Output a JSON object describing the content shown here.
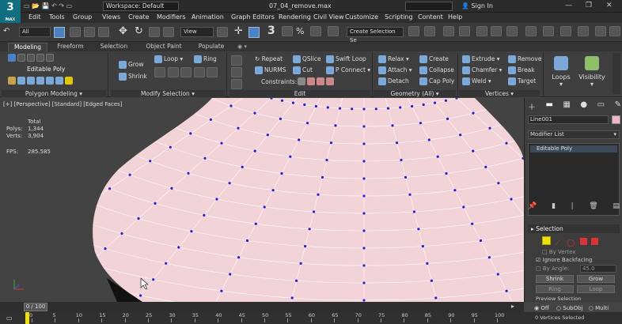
{
  "app": {
    "logo": "3",
    "logo_sub": "MAX",
    "workspace": "Workspace: Default",
    "filename": "07_04_remove.max",
    "search_placeholder": "Type a keyword or phrase",
    "sign_in": "Sign In",
    "win_min": "—",
    "win_max": "❐",
    "win_close": "✕"
  },
  "menu": [
    "Edit",
    "Tools",
    "Group",
    "Views",
    "Create",
    "Modifiers",
    "Animation",
    "Graph Editors",
    "Rendering",
    "Civil View",
    "Customize",
    "Scripting",
    "Content",
    "Help"
  ],
  "toolbar": {
    "filter": "All",
    "view": "View",
    "selection_set": "Create Selection Se"
  },
  "ribbon_tabs": [
    "Modeling",
    "Freeform",
    "Selection",
    "Object Paint",
    "Populate"
  ],
  "ribbon": {
    "editable_poly": "Editable Poly",
    "grow": "Grow",
    "shrink": "Shrink",
    "loop": "Loop",
    "ring": "Ring",
    "repeat": "Repeat",
    "qslice": "QSlice",
    "swift_loop": "Swift Loop",
    "nurms": "NURMS",
    "cut": "Cut",
    "p_connect": "P Connect",
    "constraints": "Constraints:",
    "relax": "Relax",
    "create": "Create",
    "attach": "Attach",
    "collapse": "Collapse",
    "detach": "Detach",
    "cap_poly": "Cap Poly",
    "extrude": "Extrude",
    "remove": "Remove",
    "chamfer": "Chamfer",
    "break": "Break",
    "weld": "Weld",
    "target": "Target",
    "loops": "Loops",
    "visibility": "Visibility",
    "foot_polygon": "Polygon Modeling",
    "foot_modsel": "Modify Selection",
    "foot_edit": "Edit",
    "foot_geometry": "Geometry (All)",
    "foot_vertices": "Vertices"
  },
  "viewport": {
    "label": "[+] [Perspective] [Standard] [Edged Faces]",
    "stats_total": "Total",
    "polys_label": "Polys:",
    "polys_value": "1,344",
    "verts_label": "Verts:",
    "verts_value": "3,904",
    "fps_label": "FPS:",
    "fps_value": "285.585"
  },
  "panel": {
    "object_name": "Line001",
    "modifier_list": "Modifier List",
    "stack_item": "Editable Poly",
    "selection_title": "Selection",
    "by_vertex": "By Vertex",
    "ignore_backfacing": "Ignore Backfacing",
    "by_angle": "By Angle:",
    "angle_value": "45.0",
    "shrink": "Shrink",
    "grow": "Grow",
    "ring": "Ring",
    "loop": "Loop",
    "preview_selection": "Preview Selection",
    "off": "Off",
    "subobj": "SubObj",
    "multi": "Multi",
    "status": "0 Vertices Selected"
  },
  "timeline": {
    "frame": "0 / 100",
    "ticks": [
      "0",
      "5",
      "10",
      "15",
      "20",
      "25",
      "30",
      "35",
      "40",
      "45",
      "50",
      "55",
      "60",
      "65",
      "70",
      "75",
      "80",
      "85",
      "90",
      "95",
      "100"
    ]
  },
  "colors": {
    "accent": "#0f6f80",
    "mesh": "#f2d3d7",
    "vertex": "#2a1fd8",
    "object_color": "#f2b6c8",
    "selection_vertex": "#f1e100"
  }
}
